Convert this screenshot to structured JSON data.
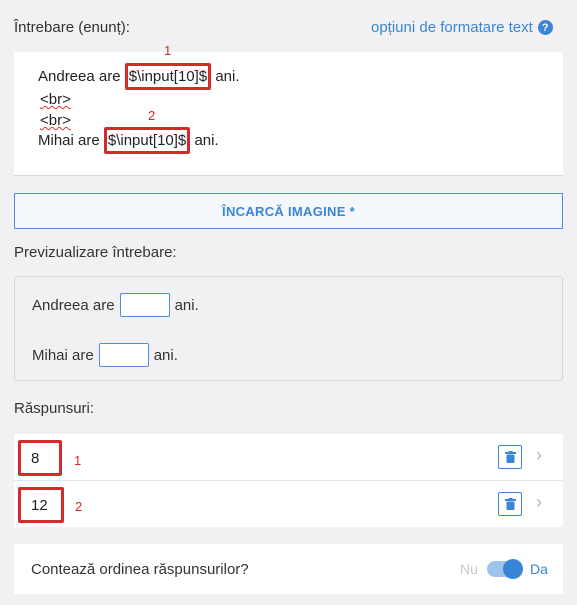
{
  "question": {
    "label": "Întrebare (enunț):",
    "format_link": "opțiuni de formatare text",
    "help_icon_glyph": "?",
    "editor_lines": {
      "line1_prefix": "Andreea are",
      "line1_token": "$\\input[10]$",
      "line1_suffix": "ani.",
      "line2": "<br>",
      "line3": "<br>",
      "line4_prefix": "Mihai are",
      "line4_token": "$\\input[10]$",
      "line4_suffix": "ani."
    },
    "markers": [
      "1",
      "2"
    ]
  },
  "upload_button": "ÎNCARCĂ IMAGINE *",
  "preview": {
    "label": "Previzualizare întrebare:",
    "line1_prefix": "Andreea are",
    "line1_suffix": "ani.",
    "line2_prefix": "Mihai are",
    "line2_suffix": "ani."
  },
  "answers": {
    "label": "Răspunsuri:",
    "items": [
      {
        "value": "8",
        "marker": "1"
      },
      {
        "value": "12",
        "marker": "2"
      }
    ]
  },
  "order": {
    "question": "Contează ordinea răspunsurilor?",
    "off_label": "Nu",
    "on_label": "Da",
    "enabled": true
  },
  "colors": {
    "accent": "#3a86d6",
    "highlight_red": "#d42a2a"
  },
  "icons": {
    "help": "help-circle-icon",
    "trash": "trash-icon",
    "chevron": "chevron-right-icon"
  }
}
